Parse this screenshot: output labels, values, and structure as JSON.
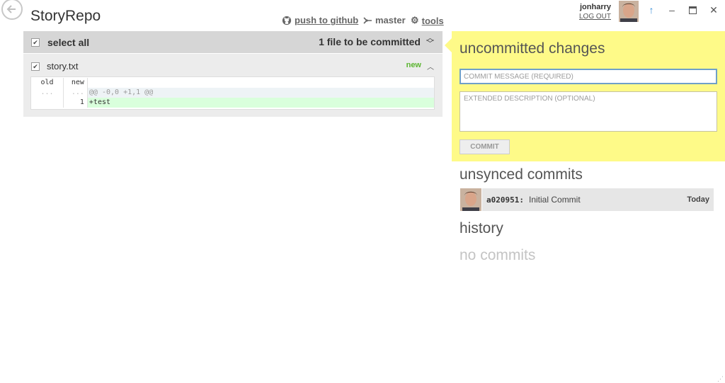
{
  "repo": {
    "name": "StoryRepo"
  },
  "toolbar": {
    "push_label": "push to github",
    "branch_label": "master",
    "tools_label": "tools"
  },
  "user": {
    "name": "jonharry",
    "logout_label": "LOG OUT"
  },
  "changes": {
    "select_all_label": "select all",
    "count_label": "1 file to be committed",
    "files": [
      {
        "name": "story.txt",
        "status": "new",
        "diff": {
          "header_old": "old",
          "header_new": "new",
          "hunk_marker": "...",
          "hunk_text": "@@ -0,0 +1,1 @@",
          "line_number": "1",
          "line_text": "+test"
        }
      }
    ]
  },
  "commit_panel": {
    "title": "uncommitted changes",
    "message_placeholder": "COMMIT MESSAGE (REQUIRED)",
    "description_placeholder": "EXTENDED DESCRIPTION (OPTIONAL)",
    "commit_label": "COMMIT"
  },
  "unsynced": {
    "title": "unsynced commits",
    "commits": [
      {
        "sha": "a020951:",
        "message": "Initial Commit",
        "date": "Today"
      }
    ]
  },
  "history": {
    "title": "history",
    "empty_label": "no commits"
  },
  "colors": {
    "panel_yellow": "#fefa88",
    "new_green": "#5cb531",
    "added_line_bg": "#d9ffdc",
    "sync_arrow": "#3a8fd8"
  }
}
